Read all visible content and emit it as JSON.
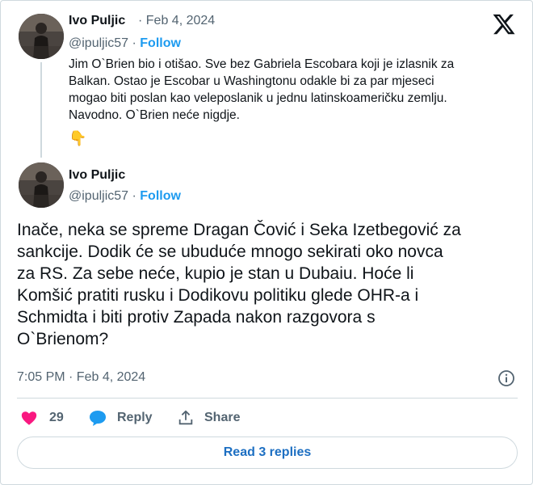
{
  "reply_tweet": {
    "author_name": "Ivo Puljic",
    "date": "· Feb 4, 2024",
    "handle": "@ipuljic57",
    "separator": " · ",
    "follow_label": "Follow",
    "text": "Jim O`Brien bio i otišao. Sve bez Gabriela Escobara koji je izlasnik za\nBalkan. Ostao je Escobar u Washingtonu odakle bi za par mjeseci\nmogao biti poslan kao veleposlanik u jednu latinskoameričku zemlju.\nNavodno. O`Brien neće nigdje.",
    "emoji": "👇"
  },
  "main_tweet": {
    "author_name": "Ivo Puljic",
    "handle": "@ipuljic57",
    "separator": " · ",
    "follow_label": "Follow",
    "text": "Inače, neka se spreme Dragan Čović i Seka Izetbegović za\nsankcije. Dodik će se ubuduće mnogo sekirati oko novca\nza RS. Za sebe neće, kupio je stan u Dubaiu. Hoće li\nKomšić pratiti rusku i Dodikovu politiku glede OHR-a i\nSchmidta i biti protiv Zapada nakon razgovora s\nO`Brienom?",
    "timestamp": "7:05 PM · Feb 4, 2024"
  },
  "actions": {
    "like_count": "29",
    "reply_label": "Reply",
    "share_label": "Share"
  },
  "read_replies_label": "Read 3 replies",
  "colors": {
    "like": "#f91880",
    "reply": "#1d9bf0",
    "link": "#1d9bf0",
    "muted": "#536471"
  },
  "icons": [
    "x-logo-icon",
    "info-icon",
    "heart-icon",
    "reply-bubble-icon",
    "share-icon",
    "pointing-down-emoji"
  ]
}
